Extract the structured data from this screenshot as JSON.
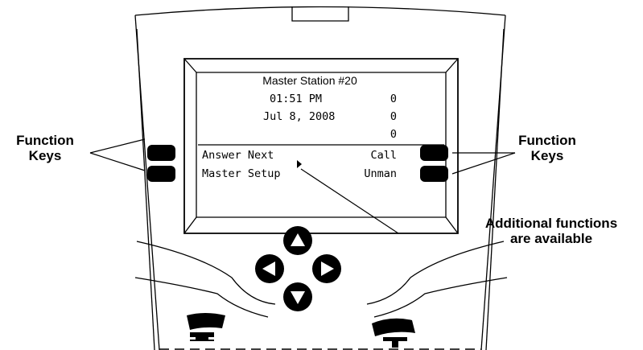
{
  "labels": {
    "left_keys_line1": "Function",
    "left_keys_line2": "Keys",
    "right_keys_line1": "Function",
    "right_keys_line2": "Keys",
    "additional_line1": "Additional functions",
    "additional_line2": "are available"
  },
  "display": {
    "title": "Master Station #20",
    "time": "01:51 PM",
    "date": "Jul 8, 2008",
    "counters": [
      "0",
      "0",
      "0"
    ],
    "softkey_left_1": "Answer Next",
    "softkey_left_2": "Master Setup",
    "softkey_right_1": "Call",
    "softkey_right_2": "Unman",
    "more_indicator_icon": "right-triangle-icon"
  },
  "navigation": {
    "up_icon": "arrow-up-icon",
    "left_icon": "arrow-left-icon",
    "right_icon": "arrow-right-icon",
    "down_icon": "arrow-down-icon"
  },
  "handset_icons": [
    "handset-hang-up-icon",
    "handset-off-hook-icon"
  ]
}
